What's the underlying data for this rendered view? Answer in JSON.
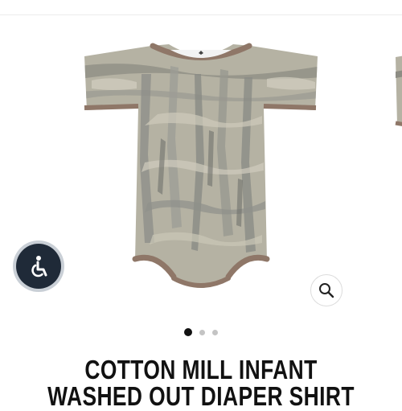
{
  "product": {
    "title": "COTTON MILL INFANT WASHED OUT DIAPER SHIRT",
    "image_icon": "camouflage-bodysuit-image"
  },
  "gallery": {
    "current_slide": 1,
    "slide_count": 3
  },
  "icons": {
    "accessibility": "accessibility-icon",
    "zoom": "magnifier-icon"
  },
  "colors": {
    "accessibility_button": "#1f2a38",
    "active_dot": "#111111",
    "inactive_dot": "#c4c4c4",
    "trim": "#8f7768",
    "camo_base": "#b5b2a3"
  }
}
